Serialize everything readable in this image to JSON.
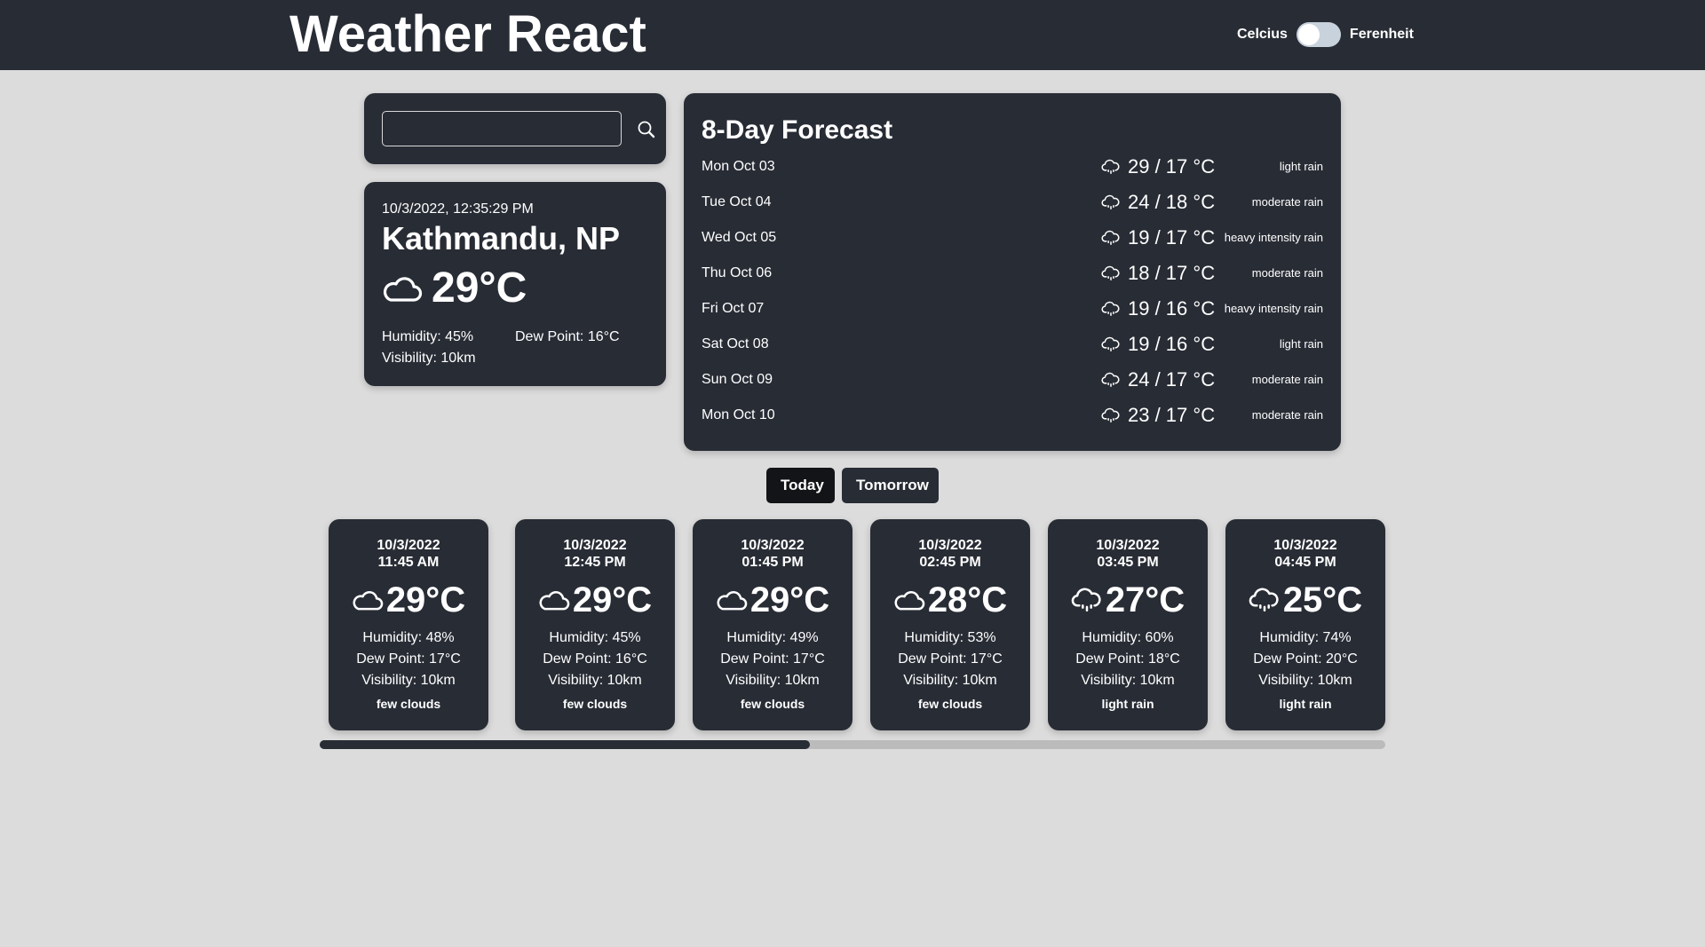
{
  "header": {
    "title": "Weather React",
    "unit_toggle": {
      "left_label": "Celcius",
      "right_label": "Ferenheit",
      "selected": "Celcius"
    }
  },
  "search": {
    "value": "",
    "placeholder": "",
    "button_icon": "search-icon"
  },
  "current": {
    "datetime": "10/3/2022, 12:35:29 PM",
    "city": "Kathmandu, NP",
    "icon": "cloud-icon",
    "temperature": "29°C",
    "humidity": "Humidity: 45%",
    "dew_point": "Dew Point: 16°C",
    "visibility": "Visibility: 10km"
  },
  "forecast": {
    "title": "8-Day Forecast",
    "days": [
      {
        "day": "Mon Oct 03",
        "icon": "rain-cloud-icon",
        "temp": "29 / 17 °C",
        "desc": "light rain"
      },
      {
        "day": "Tue Oct 04",
        "icon": "rain-cloud-icon",
        "temp": "24 / 18 °C",
        "desc": "moderate rain"
      },
      {
        "day": "Wed Oct 05",
        "icon": "rain-cloud-icon",
        "temp": "19 / 17 °C",
        "desc": "heavy intensity rain"
      },
      {
        "day": "Thu Oct 06",
        "icon": "rain-cloud-icon",
        "temp": "18 / 17 °C",
        "desc": "moderate rain"
      },
      {
        "day": "Fri Oct 07",
        "icon": "rain-cloud-icon",
        "temp": "19 / 16 °C",
        "desc": "heavy intensity rain"
      },
      {
        "day": "Sat Oct 08",
        "icon": "rain-cloud-icon",
        "temp": "19 / 16 °C",
        "desc": "light rain"
      },
      {
        "day": "Sun Oct 09",
        "icon": "rain-cloud-icon",
        "temp": "24 / 17 °C",
        "desc": "moderate rain"
      },
      {
        "day": "Mon Oct 10",
        "icon": "rain-cloud-icon",
        "temp": "23 / 17 °C",
        "desc": "moderate rain"
      }
    ]
  },
  "tabs": [
    {
      "label": "Today",
      "active": true
    },
    {
      "label": "Tomorrow",
      "active": false
    }
  ],
  "hourly": [
    {
      "date": "10/3/2022",
      "time": "11:45 AM",
      "icon": "cloud-icon",
      "temp": "29°C",
      "humidity": "Humidity: 48%",
      "dew_point": "Dew Point: 17°C",
      "visibility": "Visibility: 10km",
      "desc": "few clouds"
    },
    {
      "date": "10/3/2022",
      "time": "12:45 PM",
      "icon": "cloud-icon",
      "temp": "29°C",
      "humidity": "Humidity: 45%",
      "dew_point": "Dew Point: 16°C",
      "visibility": "Visibility: 10km",
      "desc": "few clouds"
    },
    {
      "date": "10/3/2022",
      "time": "01:45 PM",
      "icon": "cloud-icon",
      "temp": "29°C",
      "humidity": "Humidity: 49%",
      "dew_point": "Dew Point: 17°C",
      "visibility": "Visibility: 10km",
      "desc": "few clouds"
    },
    {
      "date": "10/3/2022",
      "time": "02:45 PM",
      "icon": "cloud-icon",
      "temp": "28°C",
      "humidity": "Humidity: 53%",
      "dew_point": "Dew Point: 17°C",
      "visibility": "Visibility: 10km",
      "desc": "few clouds"
    },
    {
      "date": "10/3/2022",
      "time": "03:45 PM",
      "icon": "rain-cloud-icon",
      "temp": "27°C",
      "humidity": "Humidity: 60%",
      "dew_point": "Dew Point: 18°C",
      "visibility": "Visibility: 10km",
      "desc": "light rain"
    },
    {
      "date": "10/3/2022",
      "time": "04:45 PM",
      "icon": "rain-cloud-icon",
      "temp": "25°C",
      "humidity": "Humidity: 74%",
      "dew_point": "Dew Point: 20°C",
      "visibility": "Visibility: 10km",
      "desc": "light rain"
    }
  ],
  "hourly_scroll": {
    "visible_fraction": 0.46,
    "position_fraction": 0.0
  },
  "colors": {
    "panel": "#282c35",
    "background": "#dcdcdc",
    "active_tab": "#131417",
    "text": "#ffffff",
    "scroll_track": "#bbbbbb",
    "toggle_track": "#c8d2dc"
  }
}
